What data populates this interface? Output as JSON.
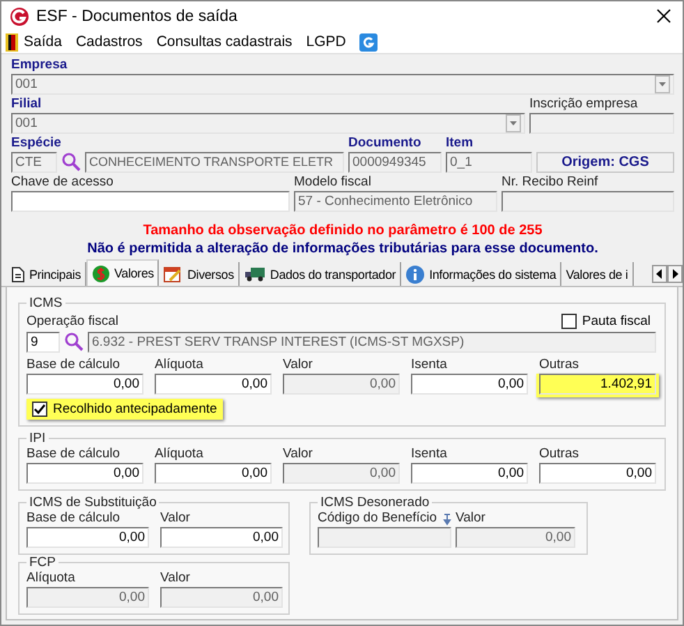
{
  "window": {
    "title": "ESF - Documentos de saída"
  },
  "menu": [
    "Saída",
    "Cadastros",
    "Consultas cadastrais",
    "LGPD"
  ],
  "empresa": {
    "label": "Empresa",
    "value": "001",
    "required": true,
    "disabled": true
  },
  "filial": {
    "label": "Filial",
    "value": "001",
    "required": true,
    "disabled": true
  },
  "inscricao": {
    "label": "Inscrição empresa",
    "required": false,
    "disabled": true
  },
  "especie": {
    "label": "Espécie",
    "code": "CTE",
    "description": "CONHECEIMENTO TRANSPORTE ELETR",
    "required": true,
    "disabled": true
  },
  "documento": {
    "label": "Documento",
    "value": "0000949345",
    "required": true,
    "disabled": true
  },
  "item": {
    "label": "Item",
    "value": "0_1",
    "required": true,
    "disabled": true
  },
  "origem": {
    "text": "Origem: CGS"
  },
  "chave": {
    "label": "Chave de acesso",
    "required": false,
    "disabled": false
  },
  "modelo": {
    "label": "Modelo fiscal",
    "value": "57 - Conhecimento Eletrônico",
    "required": false,
    "disabled": true
  },
  "recibo": {
    "label": "Nr. Recibo Reinf",
    "required": false,
    "disabled": true
  },
  "warnings": [
    {
      "text": "Tamanho da observação definido no parâmetro é 100 de 255",
      "color": "#ff0000"
    },
    {
      "text": "Não é permitida a alteração de informações tributárias para esse documento.",
      "color": "#00007f"
    }
  ],
  "tabs": [
    {
      "label": "Principais",
      "selected": false
    },
    {
      "label": "Valores",
      "selected": true
    },
    {
      "label": "Diversos",
      "selected": false
    },
    {
      "label": "Dados do transportador",
      "selected": false
    },
    {
      "label": "Informações do sistema",
      "selected": false
    },
    {
      "label": "Valores de i",
      "selected": false
    }
  ],
  "icms": {
    "title": "ICMS",
    "operation_label": "Operação fiscal",
    "operation_code": "9",
    "operation_description": "6.932 - PREST SERV TRANSP INTEREST (ICMS-ST MGXSP)",
    "pauta": {
      "label": "Pauta fiscal",
      "checked": false
    },
    "fields": [
      {
        "label": "Base de cálculo",
        "value": "0,00",
        "disabled": false,
        "highlighted": false
      },
      {
        "label": "Alíquota",
        "value": "0,00",
        "disabled": false,
        "highlighted": false
      },
      {
        "label": "Valor",
        "value": "0,00",
        "disabled": true,
        "highlighted": false
      },
      {
        "label": "Isenta",
        "value": "0,00",
        "disabled": false,
        "highlighted": false
      },
      {
        "label": "Outras",
        "value": "1.402,91",
        "disabled": false,
        "highlighted": true
      }
    ],
    "recolhido": {
      "label": "Recolhido antecipadamente",
      "checked": true,
      "highlighted": true
    }
  },
  "ipi": {
    "title": "IPI",
    "fields": [
      {
        "label": "Base de cálculo",
        "value": "0,00",
        "disabled": false
      },
      {
        "label": "Alíquota",
        "value": "0,00",
        "disabled": false
      },
      {
        "label": "Valor",
        "value": "0,00",
        "disabled": true
      },
      {
        "label": "Isenta",
        "value": "0,00",
        "disabled": false
      },
      {
        "label": "Outras",
        "value": "0,00",
        "disabled": false
      }
    ]
  },
  "icms_st": {
    "title": "ICMS de Substituição",
    "fields": [
      {
        "label": "Base de cálculo",
        "value": "0,00",
        "disabled": false
      },
      {
        "label": "Valor",
        "value": "0,00",
        "disabled": false
      }
    ]
  },
  "icms_desonerado": {
    "title": "ICMS Desonerado",
    "fields": [
      {
        "label": "Código do Benefício",
        "disabled": true
      },
      {
        "label": "Valor",
        "value": "0,00",
        "disabled": true
      }
    ]
  },
  "fcp": {
    "title": "FCP",
    "fields": [
      {
        "label": "Alíquota",
        "value": "0,00",
        "disabled": true
      },
      {
        "label": "Valor",
        "value": "0,00",
        "disabled": true
      }
    ]
  }
}
